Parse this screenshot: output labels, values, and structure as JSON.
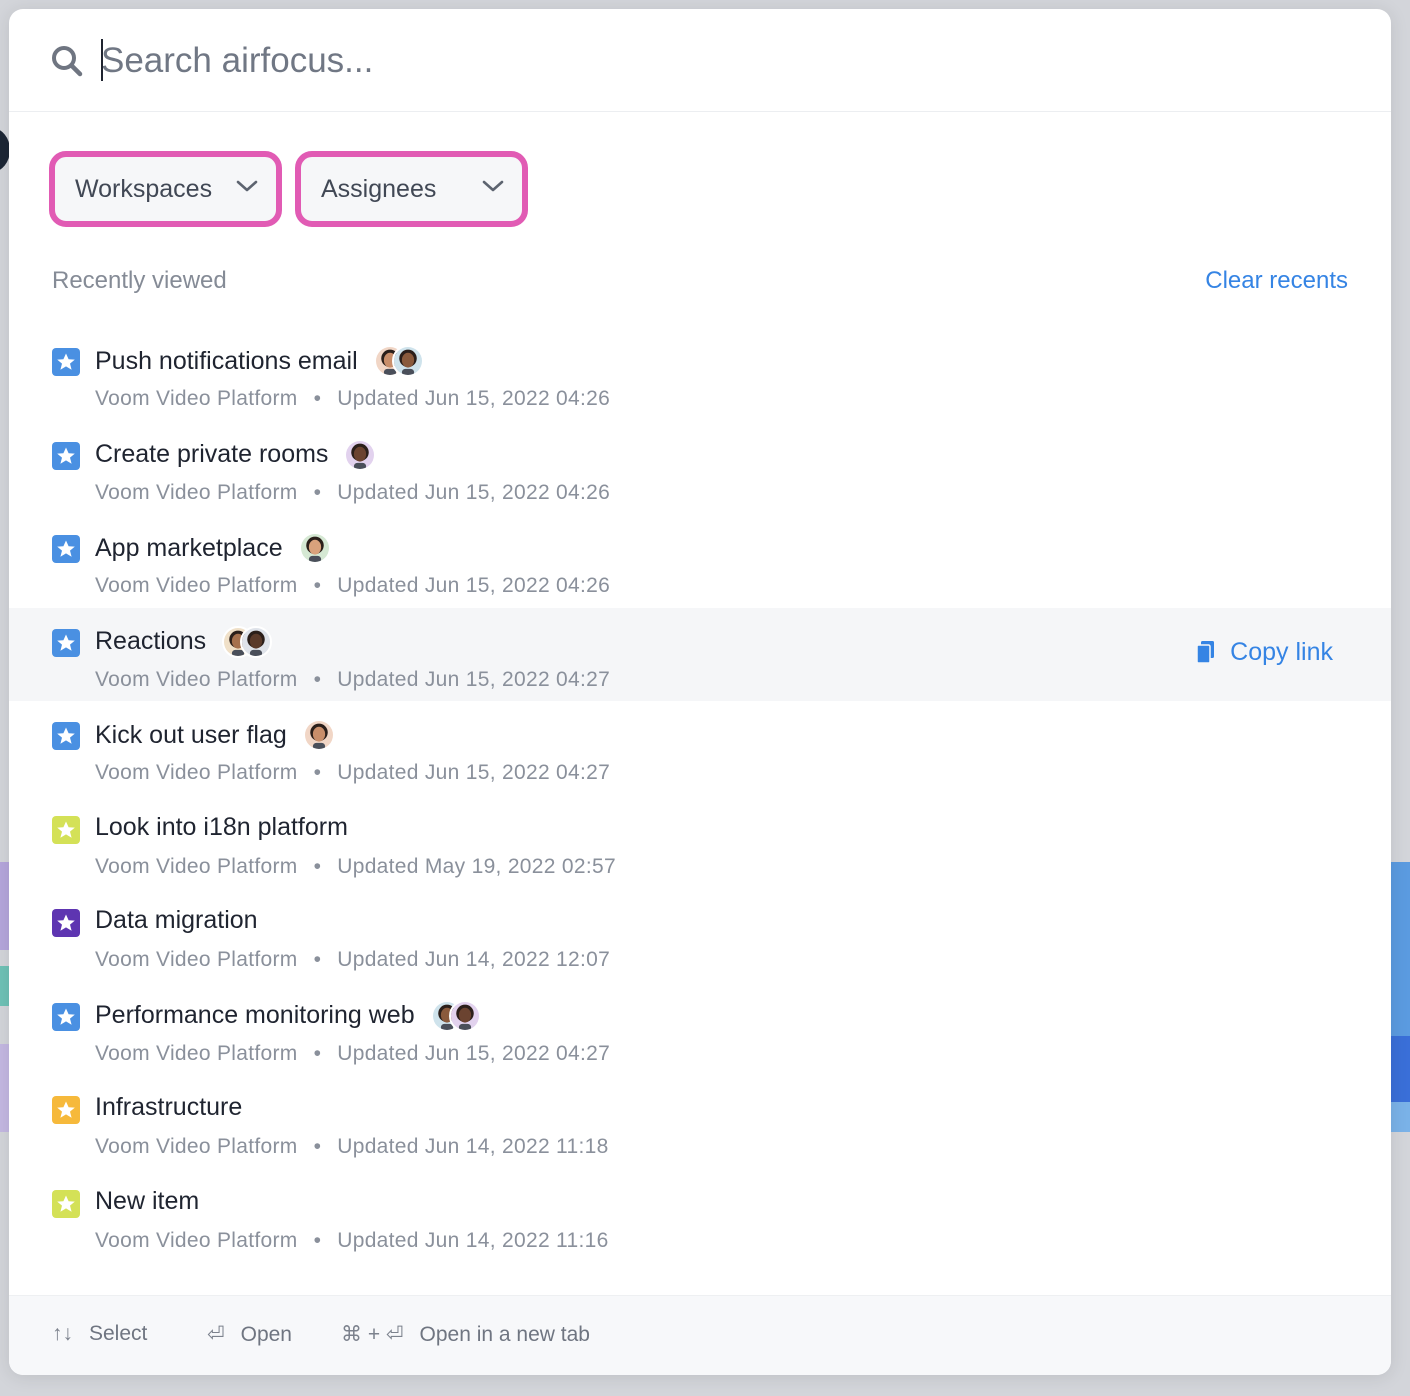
{
  "search": {
    "placeholder": "Search airfocus..."
  },
  "filters": [
    {
      "label": "Workspaces"
    },
    {
      "label": "Assignees"
    }
  ],
  "recent": {
    "heading": "Recently viewed",
    "clear_label": "Clear recents",
    "copy_link_label": "Copy link",
    "items": [
      {
        "title": "Push notifications email",
        "workspace": "Voom Video Platform",
        "updated": "Updated Jun 15, 2022 04:26",
        "star_color": "#4a90e2",
        "avatars": 2
      },
      {
        "title": "Create private rooms",
        "workspace": "Voom Video Platform",
        "updated": "Updated Jun 15, 2022 04:26",
        "star_color": "#4a90e2",
        "avatars": 1
      },
      {
        "title": "App marketplace",
        "workspace": "Voom Video Platform",
        "updated": "Updated Jun 15, 2022 04:26",
        "star_color": "#4a90e2",
        "avatars": 1
      },
      {
        "title": "Reactions",
        "workspace": "Voom Video Platform",
        "updated": "Updated Jun 15, 2022 04:27",
        "star_color": "#4a90e2",
        "avatars": 2
      },
      {
        "title": "Kick out user flag",
        "workspace": "Voom Video Platform",
        "updated": "Updated Jun 15, 2022 04:27",
        "star_color": "#4a90e2",
        "avatars": 1
      },
      {
        "title": "Look into i18n platform",
        "workspace": "Voom Video Platform",
        "updated": "Updated May 19, 2022 02:57",
        "star_color": "#d4e157",
        "avatars": 0
      },
      {
        "title": "Data migration",
        "workspace": "Voom Video Platform",
        "updated": "Updated Jun 14, 2022 12:07",
        "star_color": "#5e35b1",
        "avatars": 0
      },
      {
        "title": "Performance monitoring web",
        "workspace": "Voom Video Platform",
        "updated": "Updated Jun 15, 2022 04:27",
        "star_color": "#4a90e2",
        "avatars": 2
      },
      {
        "title": "Infrastructure",
        "workspace": "Voom Video Platform",
        "updated": "Updated Jun 14, 2022 11:18",
        "star_color": "#f6b93b",
        "avatars": 0
      },
      {
        "title": "New item",
        "workspace": "Voom Video Platform",
        "updated": "Updated Jun 14, 2022 11:16",
        "star_color": "#d4e157",
        "avatars": 0
      }
    ]
  },
  "footer": {
    "select_keys": "↑↓",
    "select_label": "Select",
    "open_keys": "⏎",
    "open_label": "Open",
    "newtab_keys": "⌘ + ⏎",
    "newtab_label": "Open in a new tab"
  },
  "colors": {
    "accent": "#3584e4",
    "highlight_outline": "#e15bb4"
  }
}
